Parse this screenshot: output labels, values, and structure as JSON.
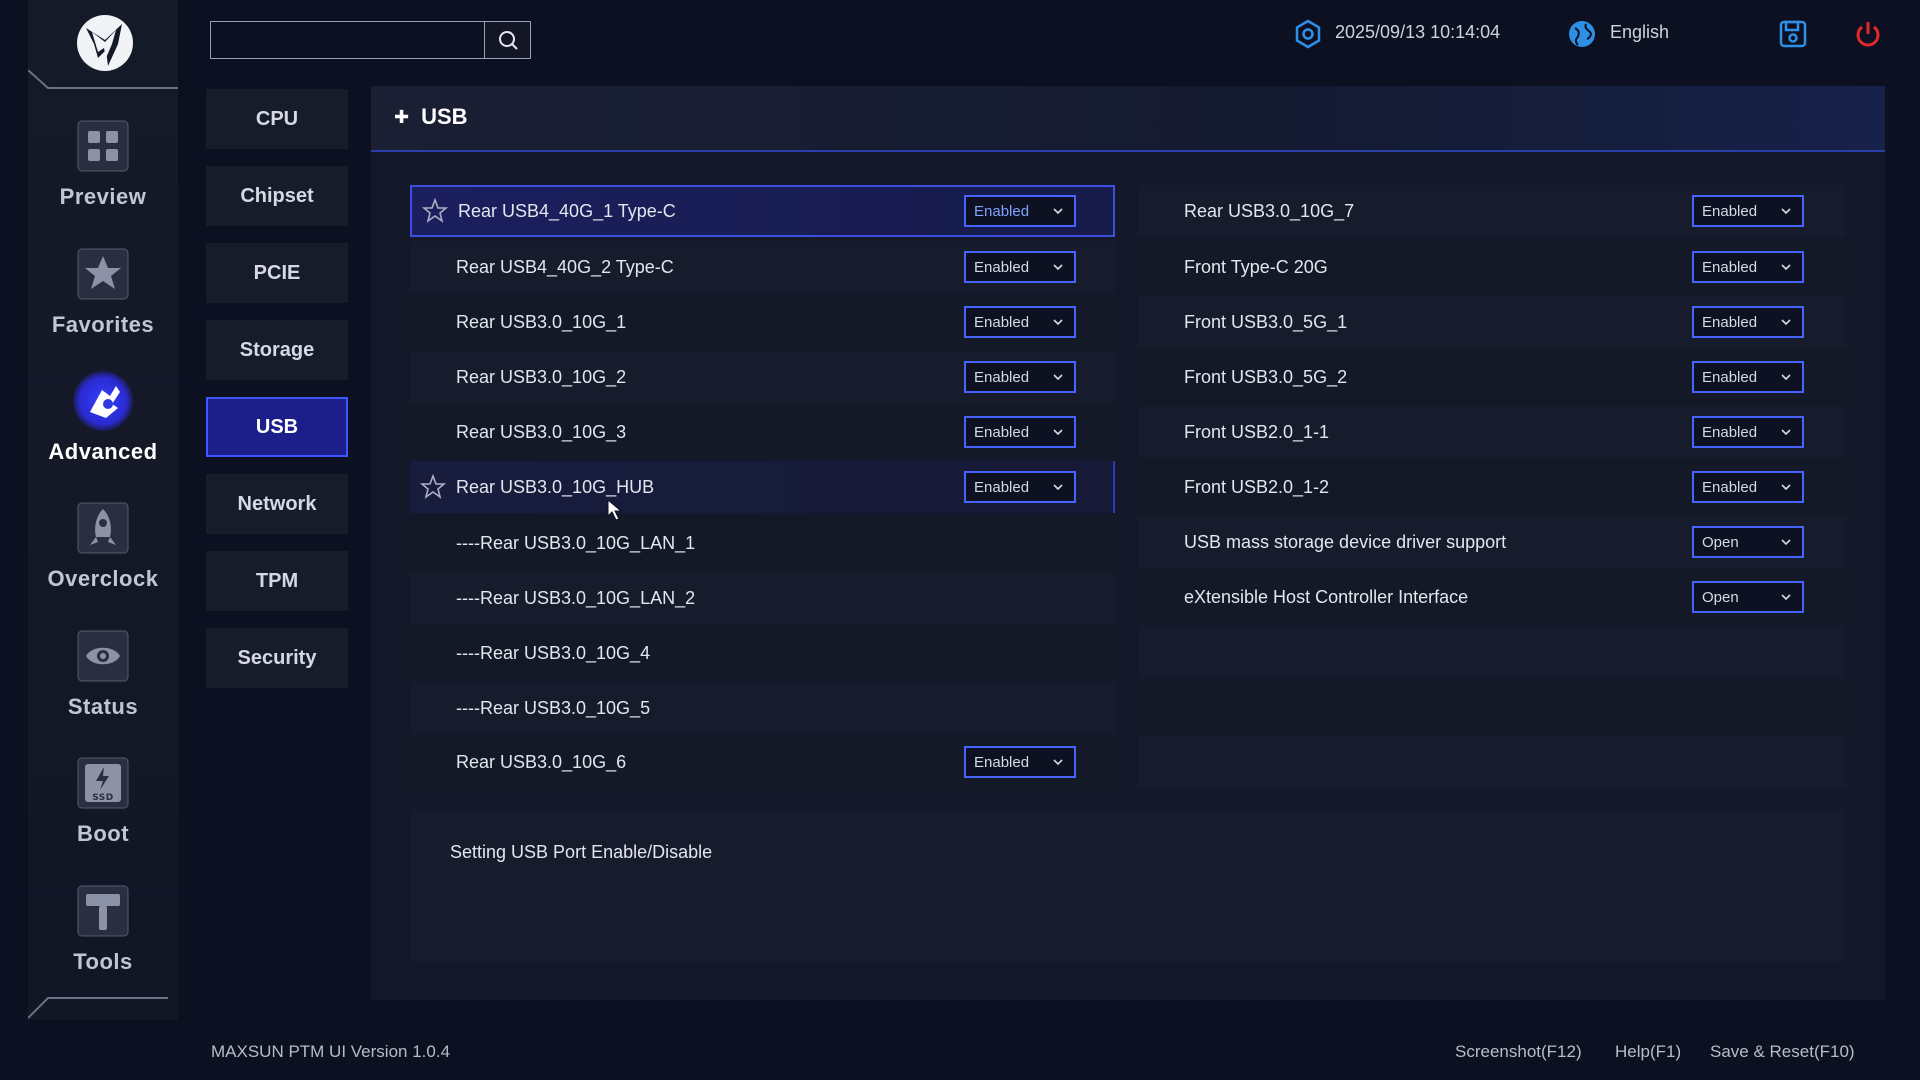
{
  "header": {
    "datetime": "2025/09/13 10:14:04",
    "language": "English"
  },
  "nav": [
    {
      "label": "Preview"
    },
    {
      "label": "Favorites"
    },
    {
      "label": "Advanced"
    },
    {
      "label": "Overclock"
    },
    {
      "label": "Status"
    },
    {
      "label": "Boot"
    },
    {
      "label": "Tools"
    }
  ],
  "submenu": [
    "CPU",
    "Chipset",
    "PCIE",
    "Storage",
    "USB",
    "Network",
    "TPM",
    "Security"
  ],
  "panel": {
    "title": "USB"
  },
  "left_settings": [
    {
      "label": "Rear USB4_40G_1 Type-C",
      "value": "Enabled"
    },
    {
      "label": "Rear USB4_40G_2 Type-C",
      "value": "Enabled"
    },
    {
      "label": "Rear USB3.0_10G_1",
      "value": "Enabled"
    },
    {
      "label": "Rear USB3.0_10G_2",
      "value": "Enabled"
    },
    {
      "label": "Rear USB3.0_10G_3",
      "value": "Enabled"
    },
    {
      "label": "Rear USB3.0_10G_HUB",
      "value": "Enabled"
    },
    {
      "label": "----Rear USB3.0_10G_LAN_1"
    },
    {
      "label": "----Rear USB3.0_10G_LAN_2"
    },
    {
      "label": "----Rear USB3.0_10G_4"
    },
    {
      "label": "----Rear USB3.0_10G_5"
    },
    {
      "label": "Rear USB3.0_10G_6",
      "value": "Enabled"
    }
  ],
  "right_settings": [
    {
      "label": "Rear USB3.0_10G_7",
      "value": "Enabled"
    },
    {
      "label": "Front Type-C 20G",
      "value": "Enabled"
    },
    {
      "label": "Front USB3.0_5G_1",
      "value": "Enabled"
    },
    {
      "label": "Front USB3.0_5G_2",
      "value": "Enabled"
    },
    {
      "label": "Front USB2.0_1-1",
      "value": "Enabled"
    },
    {
      "label": "Front USB2.0_1-2",
      "value": "Enabled"
    },
    {
      "label": "USB mass storage device driver support",
      "value": "Open"
    },
    {
      "label": "eXtensible Host Controller Interface",
      "value": "Open"
    }
  ],
  "description": "Setting USB Port Enable/Disable",
  "footer": {
    "version": "MAXSUN PTM UI Version 1.0.4",
    "screenshot": "Screenshot(F12)",
    "help": "Help(F1)",
    "save_reset": "Save & Reset(F10)"
  }
}
